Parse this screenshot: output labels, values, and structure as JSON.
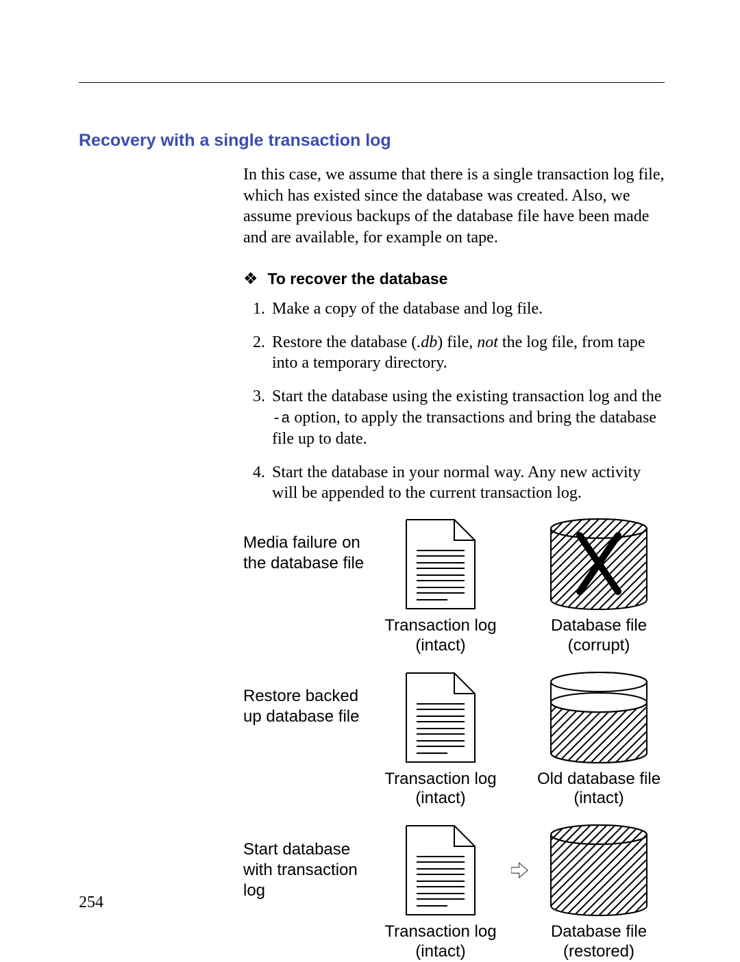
{
  "section_title": "Recovery with a single transaction log",
  "intro": "In this case, we assume that there is a single transaction log file, which has existed since the database was created. Also, we assume previous backups of the database file have been made and are available, for example on tape.",
  "subheading": "To recover the database",
  "steps": {
    "s1": "Make a copy of the database and log file.",
    "s2_a": "Restore the database (",
    "s2_db": ".db",
    "s2_b": ") file, ",
    "s2_not": "not",
    "s2_c": " the log file, from tape into a temporary directory.",
    "s3_a": "Start the database using the existing transaction log and the ",
    "s3_opt": "-a",
    "s3_b": " option, to apply the transactions and bring the database file up to date.",
    "s4": "Start the database in your normal way. Any new activity will be appended to the current transaction log."
  },
  "diagram": {
    "row1": {
      "label": "Media failure on the database file",
      "log_caption": "Transaction log (intact)",
      "db_caption": "Database file (corrupt)"
    },
    "row2": {
      "label": "Restore backed up database file",
      "log_caption": "Transaction log (intact)",
      "db_caption": "Old database file (intact)"
    },
    "row3": {
      "label": "Start database with transaction log",
      "log_caption": "Transaction log (intact)",
      "db_caption": "Database file (restored)"
    }
  },
  "page_number": "254"
}
